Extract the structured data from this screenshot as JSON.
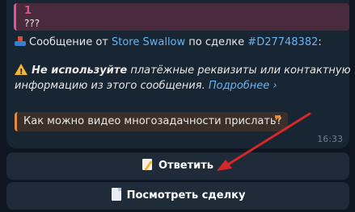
{
  "reply_quote": {
    "author": "1",
    "text": "???"
  },
  "message": {
    "line1_prefix": "Сообщение от ",
    "store_link": "Store Swallow",
    "line1_middle": " по сделке ",
    "deal_link": "#D27748382",
    "line1_suffix": ":",
    "warning_bold": "Не используйте",
    "warning_rest_line1": " платёжные реквизиты или контактную",
    "warning_line2": "информацию из этого сообщения. ",
    "more_link": "Подробнее ›",
    "question": "Как можно видео многозадачности прислать?",
    "quote_mark": "❞",
    "time": "16:33"
  },
  "buttons": {
    "reply_label": "Ответить",
    "view_deal_label": "Посмотреть сделку"
  },
  "colors": {
    "background": "#0e1621",
    "bubble": "#182533",
    "link": "#6ab3f3",
    "reply_accent": "#e0558a",
    "question_accent": "#e88a3c",
    "annotation_arrow": "#d62828"
  },
  "icons": {
    "line1": "inbox-tray-icon",
    "warning": "warning-icon",
    "reply_button": "memo-icon",
    "view_button": "page-icon",
    "quote": "quote-icon"
  }
}
